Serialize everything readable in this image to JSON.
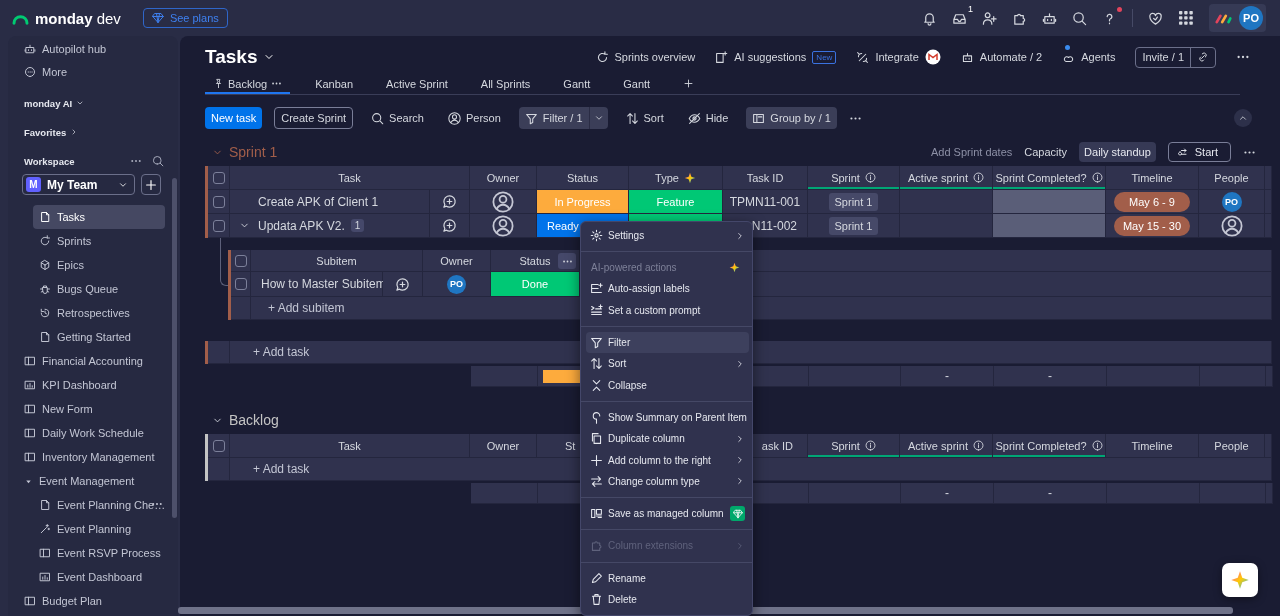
{
  "topbar": {
    "brand": "**monday** dev",
    "plans_button": "See plans",
    "inbox_badge": "1",
    "avatar": "PO"
  },
  "sidebar": {
    "shortcuts": [
      {
        "kind": "autopilot",
        "label": "Autopilot hub"
      },
      {
        "kind": "more",
        "label": "More"
      }
    ],
    "sections": [
      {
        "kind": "menu",
        "label": "monday AI"
      },
      {
        "kind": "section",
        "label": "Favorites"
      }
    ],
    "workspace": {
      "label": "Workspace",
      "initial": "M",
      "name": "My Team"
    },
    "items": [
      {
        "kind": "folder-contents",
        "children": [
          {
            "kind": "doc",
            "label": "Tasks",
            "selected": true,
            "hovered": false
          },
          {
            "kind": "sprints",
            "label": "Sprints",
            "selected": false,
            "hovered": false
          },
          {
            "kind": "epics",
            "label": "Epics",
            "selected": false,
            "hovered": false
          },
          {
            "kind": "bugs",
            "label": "Bugs Queue",
            "selected": false,
            "hovered": false
          },
          {
            "kind": "retro",
            "label": "Retrospectives",
            "selected": false,
            "hovered": false
          },
          {
            "kind": "doc",
            "label": "Getting Started",
            "selected": false,
            "hovered": false
          }
        ]
      },
      {
        "kind": "board",
        "label": "Financial Accounting",
        "selected": false,
        "hovered": false
      },
      {
        "kind": "dashboard",
        "label": "KPI Dashboard",
        "selected": false,
        "hovered": false
      },
      {
        "kind": "board",
        "label": "New Form",
        "selected": false,
        "hovered": false
      },
      {
        "kind": "board",
        "label": "Daily Work Schedule",
        "selected": false,
        "hovered": false
      },
      {
        "kind": "board",
        "label": "Inventory Management",
        "selected": false,
        "hovered": false
      },
      {
        "kind": "folder",
        "label": "Event Management",
        "expanded": true,
        "selected": false,
        "hovered": false,
        "children": [
          {
            "kind": "doc",
            "label": "Event Planning Che…",
            "selected": false,
            "hovered": true
          },
          {
            "kind": "workflow",
            "label": "Event Planning",
            "selected": false,
            "hovered": false
          },
          {
            "kind": "board",
            "label": "Event RSVP Process",
            "selected": false,
            "hovered": false
          },
          {
            "kind": "dashboard",
            "label": "Event Dashboard",
            "selected": false,
            "hovered": false
          }
        ]
      },
      {
        "kind": "board",
        "label": "Budget Plan",
        "selected": false,
        "hovered": false
      }
    ]
  },
  "board": {
    "title": "Tasks",
    "actions": [
      {
        "kind": "sprints",
        "label": "Sprints overview"
      },
      {
        "kind": "ai",
        "label": "AI suggestions",
        "badge": "New"
      },
      {
        "kind": "integrate",
        "label": "Integrate"
      },
      {
        "kind": "automate",
        "label": "Automate / 2"
      },
      {
        "kind": "agents",
        "label": "Agents"
      }
    ],
    "invite": "Invite / 1",
    "views": [
      {
        "label": "Backlog",
        "selected": true,
        "pinned": true
      },
      {
        "label": "Kanban",
        "selected": false,
        "pinned": false
      },
      {
        "label": "Active Sprint",
        "selected": false,
        "pinned": false
      },
      {
        "label": "All Sprints",
        "selected": false,
        "pinned": false
      },
      {
        "label": "Gantt",
        "selected": false,
        "pinned": false
      },
      {
        "label": "Gantt",
        "selected": false,
        "pinned": false
      }
    ],
    "toolbar": {
      "primary": "New task",
      "secondary": "Create Sprint",
      "tools": [
        {
          "kind": "search",
          "label": "Search",
          "active": false
        },
        {
          "kind": "person",
          "label": "Person",
          "active": false
        },
        {
          "kind": "filter",
          "label": "Filter / 1",
          "active": true
        },
        {
          "kind": "sort",
          "label": "Sort",
          "active": false
        },
        {
          "kind": "hide",
          "label": "Hide",
          "active": false
        },
        {
          "kind": "group",
          "label": "Group by / 1",
          "active": true
        }
      ]
    },
    "groups": [
      {
        "title": "Sprint 1",
        "color": "#a25e4a",
        "expanded": true,
        "all_checked": false,
        "actions": [
          {
            "kind": "link",
            "label": "Add Sprint dates"
          },
          {
            "kind": "text",
            "label": "Capacity"
          },
          {
            "kind": "chip",
            "label": "Daily standup"
          },
          {
            "kind": "button",
            "label": "Start"
          }
        ],
        "columns": [
          {
            "label": "Task"
          },
          {
            "label": "Owner"
          },
          {
            "label": "Status"
          },
          {
            "label": "Type",
            "ai": true
          },
          {
            "label": "Task ID"
          },
          {
            "label": "Sprint",
            "info": true,
            "linked": true
          },
          {
            "label": "Active sprint",
            "info": true,
            "linked": true
          },
          {
            "label": "Sprint Completed?",
            "info": true,
            "linked": true
          },
          {
            "label": "Timeline"
          },
          {
            "label": "People"
          }
        ],
        "rows": [
          {
            "checked": false,
            "task": "Create APK of Client 1",
            "expanded": false,
            "owner": {
              "kind": "empty"
            },
            "status": {
              "label": "In Progress",
              "color": "#fdab3d",
              "clip_end": false
            },
            "type": {
              "label": "Feature",
              "color": "#00c875"
            },
            "task_id": {
              "text": "TPMN11-001",
              "clip_start": false
            },
            "sprint": "Sprint 1",
            "timeline": "May 6 - 9",
            "people": {
              "kind": "avatar",
              "initials": "PO"
            }
          },
          {
            "checked": false,
            "task": "Updata APK V2.",
            "expanded": true,
            "subitem_count": "1",
            "owner": {
              "kind": "empty"
            },
            "status": {
              "label": "Ready",
              "color": "#0073ea",
              "clip_end": true
            },
            "type": {
              "color": "#00c875"
            },
            "task_id": {
              "text": "N11-002",
              "clip_start": true
            },
            "sprint": "Sprint 1",
            "timeline": "May 15 - 30",
            "people": {
              "kind": "empty"
            },
            "subitems": {
              "all_checked": false,
              "columns": [
                {
                  "label": "Subitem",
                  "menu": false
                },
                {
                  "label": "Owner",
                  "menu": false
                },
                {
                  "label": "Status",
                  "menu": true
                }
              ],
              "rows": [
                {
                  "checked": false,
                  "name": "How to Master Subitem",
                  "owner": {
                    "kind": "avatar",
                    "initials": "PO"
                  },
                  "status": {
                    "label": "Done",
                    "color": "#00c875",
                    "clip_end": false
                  }
                }
              ],
              "add_label": "+ Add subitem"
            }
          }
        ],
        "add_label": "+ Add task",
        "summary": {
          "active_sprint": "-",
          "sprint_completed": "-"
        }
      },
      {
        "title": "Backlog",
        "color": "#c4c4c4",
        "expanded": true,
        "all_checked": false,
        "columns": [
          {
            "label": "Task"
          },
          {
            "label": "Owner"
          },
          {
            "label": "St",
            "clip_end": true
          },
          {},
          {
            "label": "ask ID",
            "clip_start": true
          },
          {
            "label": "Sprint",
            "info": true,
            "linked": true
          },
          {
            "label": "Active sprint",
            "info": true,
            "linked": true
          },
          {
            "label": "Sprint Completed?",
            "info": true,
            "linked": true
          },
          {
            "label": "Timeline"
          },
          {
            "label": "People"
          }
        ],
        "add_label": "+ Add task",
        "summary": {
          "active_sprint": "-",
          "sprint_completed": "-"
        }
      }
    ]
  },
  "column_menu": {
    "items": [
      {
        "kind": "settings",
        "label": "Settings",
        "submenu": true,
        "hovered": false,
        "disabled": false
      },
      {
        "kind": "divider"
      },
      {
        "kind": "heading",
        "label": "AI-powered actions",
        "ai": true
      },
      {
        "kind": "labels",
        "label": "Auto-assign labels",
        "submenu": false,
        "hovered": false,
        "disabled": false
      },
      {
        "kind": "prompt",
        "label": "Set a custom prompt",
        "submenu": false,
        "hovered": false,
        "disabled": false
      },
      {
        "kind": "divider"
      },
      {
        "kind": "filter",
        "label": "Filter",
        "submenu": false,
        "hovered": true,
        "disabled": false
      },
      {
        "kind": "sort",
        "label": "Sort",
        "submenu": true,
        "hovered": false,
        "disabled": false
      },
      {
        "kind": "collapse",
        "label": "Collapse",
        "submenu": false,
        "hovered": false,
        "disabled": false
      },
      {
        "kind": "divider"
      },
      {
        "kind": "summary",
        "label": "Show Summary on Parent Item",
        "submenu": false,
        "hovered": false,
        "disabled": false
      },
      {
        "kind": "duplicate",
        "label": "Duplicate column",
        "submenu": true,
        "hovered": false,
        "disabled": false
      },
      {
        "kind": "add",
        "label": "Add column to the right",
        "submenu": true,
        "hovered": false,
        "disabled": false
      },
      {
        "kind": "change",
        "label": "Change column type",
        "submenu": true,
        "hovered": false,
        "disabled": false
      },
      {
        "kind": "divider"
      },
      {
        "kind": "managed",
        "label": "Save as managed column",
        "submenu": false,
        "premium": true,
        "hovered": false,
        "disabled": false
      },
      {
        "kind": "divider"
      },
      {
        "kind": "extensions",
        "label": "Column extensions",
        "submenu": true,
        "hovered": false,
        "disabled": true
      },
      {
        "kind": "divider"
      },
      {
        "kind": "rename",
        "label": "Rename",
        "submenu": false,
        "hovered": false,
        "disabled": false
      },
      {
        "kind": "delete",
        "label": "Delete",
        "submenu": false,
        "hovered": false,
        "disabled": false
      }
    ]
  }
}
